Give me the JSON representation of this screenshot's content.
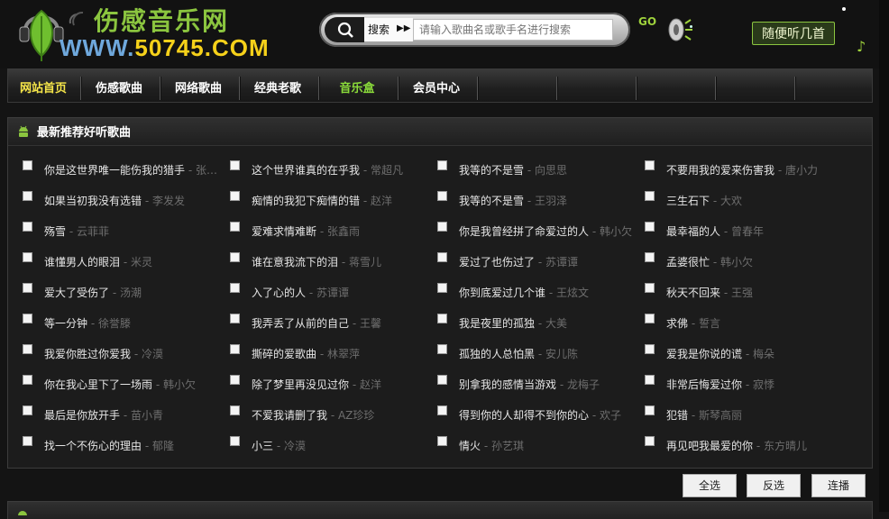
{
  "header": {
    "logo_title": "伤感音乐网",
    "logo_url_www": "WWW.",
    "logo_url_domain": "50745.COM",
    "search_label": "搜索",
    "search_placeholder": "请输入歌曲名或歌手名进行搜索",
    "go_label": "GO",
    "random_label": "随便听几首"
  },
  "nav": {
    "items": [
      {
        "label": "网站首页"
      },
      {
        "label": "伤感歌曲"
      },
      {
        "label": "网络歌曲"
      },
      {
        "label": "经典老歌"
      },
      {
        "label": "音乐盒"
      },
      {
        "label": "会员中心"
      }
    ]
  },
  "panel": {
    "title": "最新推荐好听歌曲",
    "songs": [
      {
        "title": "你是这世界唯一能伤我的猎手",
        "artist": " - 张…"
      },
      {
        "title": "这个世界谁真的在乎我",
        "artist": " - 常超凡"
      },
      {
        "title": "我等的不是雪",
        "artist": " - 向思思"
      },
      {
        "title": "不要用我的爱来伤害我",
        "artist": " - 唐小力"
      },
      {
        "title": "如果当初我没有选错",
        "artist": " - 李发发"
      },
      {
        "title": "痴情的我犯下痴情的错",
        "artist": " - 赵洋"
      },
      {
        "title": "我等的不是雪",
        "artist": " - 王羽泽"
      },
      {
        "title": "三生石下",
        "artist": " - 大欢"
      },
      {
        "title": "殇雪",
        "artist": " - 云菲菲"
      },
      {
        "title": "爱难求情难断",
        "artist": " - 张鑫雨"
      },
      {
        "title": "你是我曾经拼了命爱过的人",
        "artist": " - 韩小欠"
      },
      {
        "title": "最幸福的人",
        "artist": " - 曾春年"
      },
      {
        "title": "谁懂男人的眼泪",
        "artist": " - 米灵"
      },
      {
        "title": "谁在意我流下的泪",
        "artist": " - 蒋雪儿"
      },
      {
        "title": "爱过了也伤过了",
        "artist": " - 苏谭谭"
      },
      {
        "title": "孟婆很忙",
        "artist": " - 韩小欠"
      },
      {
        "title": "爱大了受伤了",
        "artist": " - 汤潮"
      },
      {
        "title": "入了心的人",
        "artist": " - 苏谭谭"
      },
      {
        "title": "你到底爱过几个谁",
        "artist": " - 王炫文"
      },
      {
        "title": "秋天不回来",
        "artist": " - 王强"
      },
      {
        "title": "等一分钟",
        "artist": " - 徐誉滕"
      },
      {
        "title": "我弄丢了从前的自己",
        "artist": " - 王馨"
      },
      {
        "title": "我是夜里的孤独",
        "artist": " - 大美"
      },
      {
        "title": "求佛",
        "artist": " - 誓言"
      },
      {
        "title": "我爱你胜过你爱我",
        "artist": " - 冷漠"
      },
      {
        "title": "撕碎的爱歌曲",
        "artist": " - 林翠萍"
      },
      {
        "title": "孤独的人总怕黑",
        "artist": " - 安儿陈"
      },
      {
        "title": "爱我是你说的谎",
        "artist": " - 梅朵"
      },
      {
        "title": "你在我心里下了一场雨",
        "artist": " - 韩小欠"
      },
      {
        "title": "除了梦里再没见过你",
        "artist": " - 赵洋"
      },
      {
        "title": "别拿我的感情当游戏",
        "artist": " - 龙梅子"
      },
      {
        "title": "非常后悔爱过你",
        "artist": " - 寂悸"
      },
      {
        "title": "最后是你放开手",
        "artist": " - 苗小青"
      },
      {
        "title": "不爱我请删了我",
        "artist": " - AZ珍珍"
      },
      {
        "title": "得到你的人却得不到你的心",
        "artist": " - 欢子"
      },
      {
        "title": "犯错",
        "artist": " - 斯琴高丽"
      },
      {
        "title": "找一个不伤心的理由",
        "artist": " - 郁隆"
      },
      {
        "title": "小三",
        "artist": " - 冷漠"
      },
      {
        "title": "情火",
        "artist": " - 孙艺琪"
      },
      {
        "title": "再见吧我最爱的你",
        "artist": " - 东方晴儿"
      }
    ]
  },
  "actions": {
    "select_all": "全选",
    "invert": "反选",
    "play": "连播"
  },
  "colors": {
    "brand_green": "#8bc53f",
    "logo_yellow": "#f6d11a",
    "nav_active": "#f6e64a",
    "background": "#141414"
  }
}
